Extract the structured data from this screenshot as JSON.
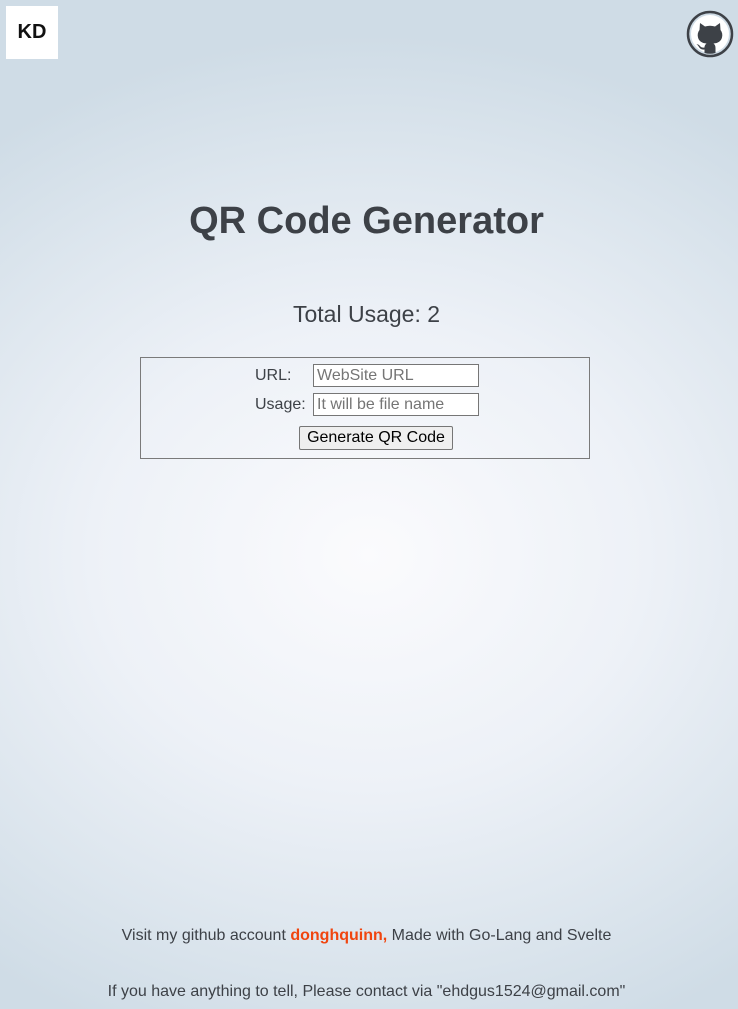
{
  "header": {
    "logo_text": "KD",
    "github_icon": "github-octocat-icon"
  },
  "main": {
    "title": "QR Code Generator",
    "total_usage_label": "Total Usage: 2"
  },
  "form": {
    "url_label": "URL:",
    "url_placeholder": "WebSite URL",
    "url_value": "",
    "usage_label": "Usage:",
    "usage_placeholder": "It will be file name",
    "usage_value": "",
    "submit_label": "Generate QR Code"
  },
  "footer": {
    "line1_prefix": "Visit my github account ",
    "github_user": "donghquinn,",
    "line1_suffix": " Made with Go-Lang and Svelte",
    "line2": "If you have anything to tell, Please contact via \"ehdgus1524@gmail.com\""
  },
  "colors": {
    "accent_link": "#f0450f",
    "text": "#3d4147"
  }
}
